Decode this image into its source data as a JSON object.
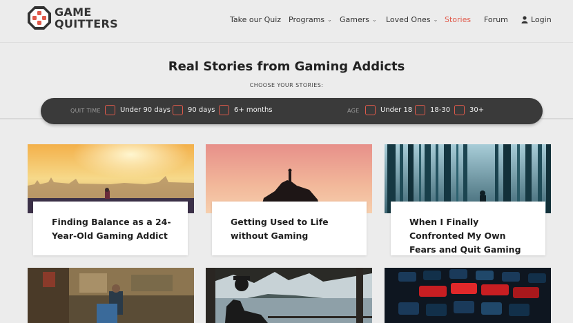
{
  "brand": {
    "line1": "GAME",
    "line2": "QUITTERS",
    "accent": "#e05a4b"
  },
  "nav": {
    "quiz": "Take our Quiz",
    "programs": "Programs",
    "gamers": "Gamers",
    "loved_ones": "Loved Ones",
    "stories": "Stories",
    "forum": "Forum",
    "login": "Login"
  },
  "hero": {
    "title": "Real Stories from Gaming Addicts",
    "subtitle": "CHOOSE YOUR STORIES:"
  },
  "filters": {
    "quit_time_label": "QUIT TIME",
    "quit_time_options": [
      "Under 90 days",
      "90 days",
      "6+ months"
    ],
    "age_label": "AGE",
    "age_options": [
      "Under 18",
      "18-30",
      "30+"
    ]
  },
  "stories": [
    {
      "title": "Finding Balance as a 24-Year-Old Gaming Addict"
    },
    {
      "title": "Getting Used to Life without Gaming"
    },
    {
      "title": "When I Finally Confronted My Own Fears and Quit Gaming"
    }
  ]
}
